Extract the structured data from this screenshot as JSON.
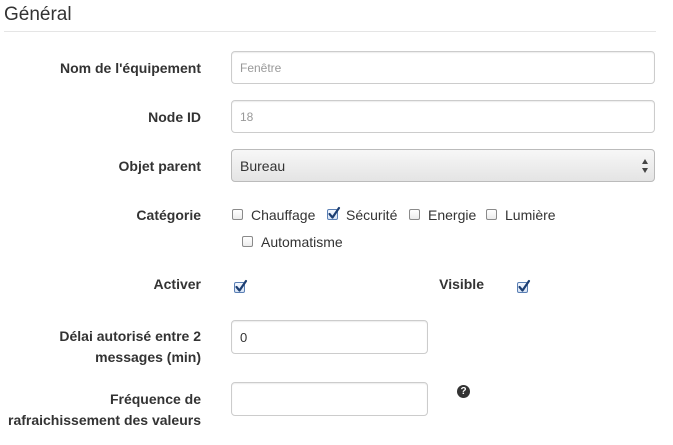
{
  "section": {
    "legend": "Général"
  },
  "fields": {
    "name": {
      "label": "Nom de l'équipement",
      "placeholder": "Fenêtre"
    },
    "node_id": {
      "label": "Node ID",
      "placeholder": "18"
    },
    "parent": {
      "label": "Objet parent",
      "selected": "Bureau"
    },
    "category": {
      "label": "Catégorie",
      "options": [
        {
          "label": "Chauffage",
          "checked": false
        },
        {
          "label": "Sécurité",
          "checked": true
        },
        {
          "label": "Energie",
          "checked": false
        },
        {
          "label": "Lumière",
          "checked": false
        },
        {
          "label": "Automatisme",
          "checked": false
        }
      ]
    },
    "activate": {
      "label": "Activer",
      "checked": true
    },
    "visible": {
      "label": "Visible",
      "checked": true
    },
    "delay": {
      "label_line1": "Délai autorisé entre 2",
      "label_line2": "messages (min)",
      "value": "0"
    },
    "refresh": {
      "label_line1": "Fréquence de",
      "label_line2": "rafraichissement des valeurs",
      "value": ""
    }
  },
  "icons": {
    "help": "question-circle-icon",
    "check": "check-icon",
    "select_arrows": "select-arrows-icon"
  },
  "colors": {
    "check": "#1d3f73",
    "checkbox_checked_border": "#5a7fb4",
    "input_border": "#cccccc"
  }
}
